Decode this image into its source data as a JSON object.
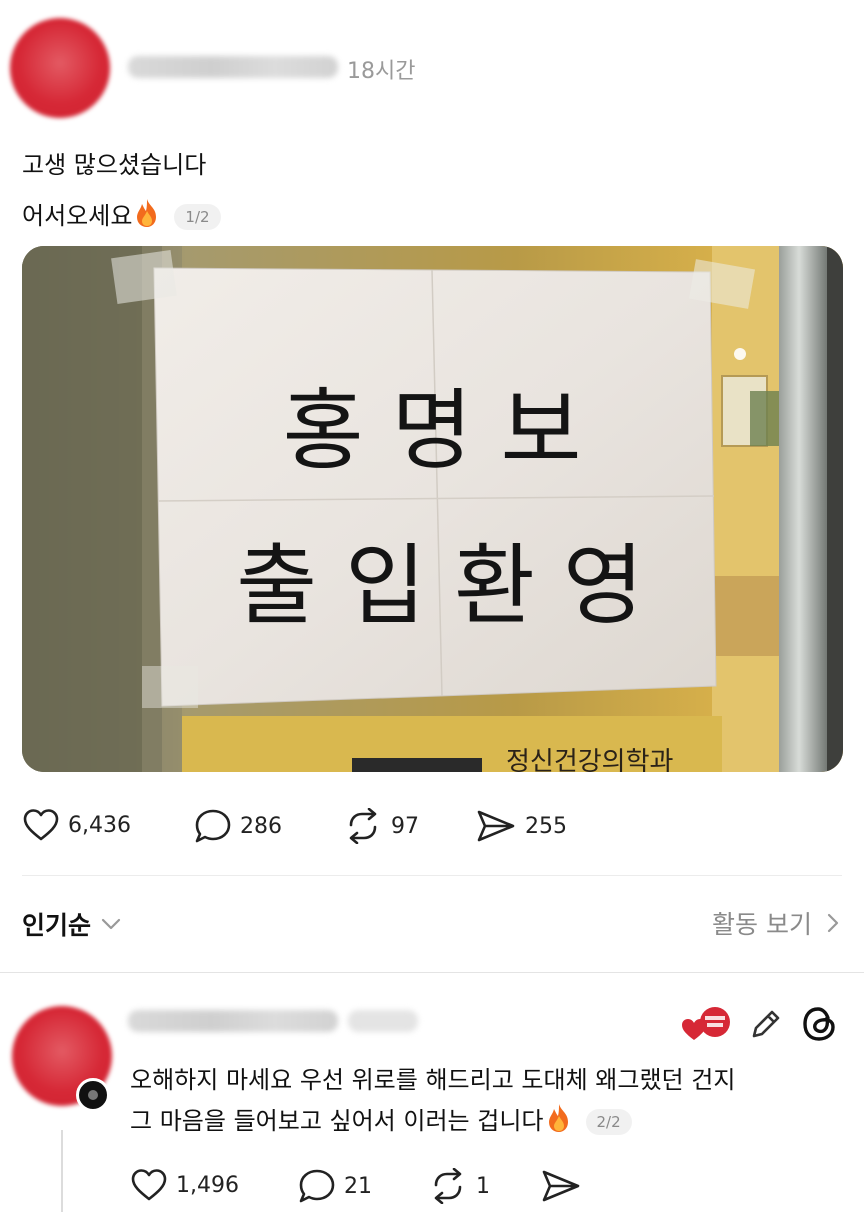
{
  "post": {
    "time": "18시간",
    "line1": "고생 많으셨습니다",
    "line2": "어서오세요",
    "page_indicator": "1/2",
    "image_text": {
      "line1": "홍 명 보",
      "line2": "출 입 환 영",
      "sign": "정신건강의학과"
    },
    "likes": "6,436",
    "replies": "286",
    "reposts": "97",
    "shares": "255"
  },
  "sort_bar": {
    "label": "인기순",
    "activity_link": "활동 보기"
  },
  "reply": {
    "line1": "오해하지 마세요 우선 위로를 해드리고 도대체 왜그랬던 건지",
    "line2": "그 마음을 들어보고 싶어서 이러는 겁니다",
    "page_indicator": "2/2",
    "likes": "1,496",
    "replies": "21",
    "reposts": "1"
  },
  "colors": {
    "brand_red": "#d62836",
    "fire": "#f26b1d"
  }
}
